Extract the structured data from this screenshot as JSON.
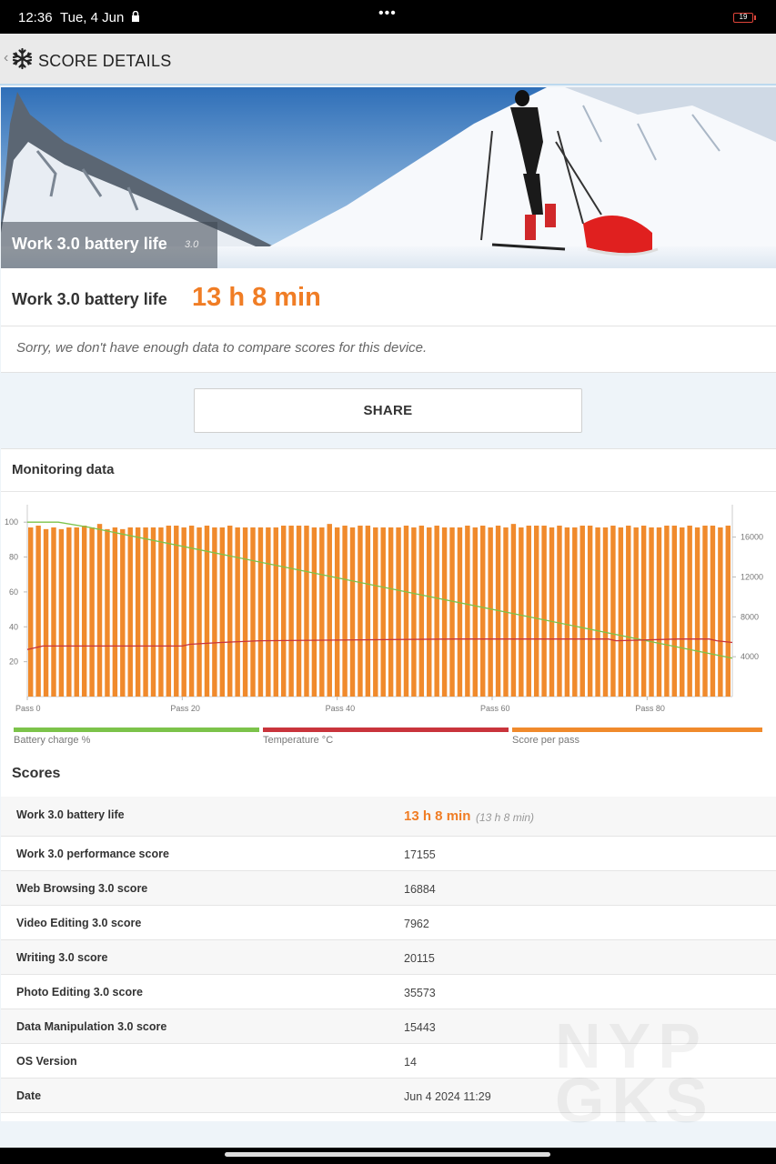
{
  "status_bar": {
    "time": "12:36",
    "date": "Tue, 4 Jun",
    "more_label": "•••",
    "battery_level": "19"
  },
  "app_bar": {
    "back_label": "‹",
    "title": "SCORE DETAILS"
  },
  "hero": {
    "title": "Work 3.0 battery life",
    "version": "3.0"
  },
  "result": {
    "label": "Work 3.0 battery life",
    "value": "13 h 8 min"
  },
  "notice": "Sorry, we don't have enough data to compare scores for this device.",
  "share_label": "SHARE",
  "monitoring": {
    "title": "Monitoring data"
  },
  "chart_data": {
    "type": "bar",
    "title": "",
    "x_tick_labels": [
      "Pass 0",
      "Pass 20",
      "Pass 40",
      "Pass 60",
      "Pass 80"
    ],
    "x_range": [
      0,
      91
    ],
    "y_left_ticks": [
      20,
      40,
      60,
      80,
      100
    ],
    "y_left_range": [
      0,
      110
    ],
    "y_right_ticks": [
      4000,
      8000,
      12000,
      16000
    ],
    "y_right_range": [
      0,
      19250
    ],
    "grid": true,
    "legend_placement": "bottom",
    "series": [
      {
        "name": "Score per pass",
        "axis": "right",
        "color": "#f08a2c",
        "values": [
          16970,
          17150,
          16800,
          16970,
          16800,
          16970,
          16970,
          17150,
          16970,
          17320,
          16800,
          16970,
          16800,
          16970,
          16970,
          16970,
          16970,
          16970,
          17150,
          17150,
          16970,
          17150,
          16970,
          17150,
          16970,
          16970,
          17150,
          16970,
          16970,
          16970,
          16970,
          16970,
          16970,
          17150,
          17150,
          17150,
          17150,
          16970,
          16970,
          17320,
          16970,
          17150,
          16970,
          17150,
          17150,
          16970,
          16970,
          16970,
          16970,
          17150,
          16970,
          17150,
          16970,
          17150,
          16970,
          16970,
          16970,
          17150,
          16970,
          17150,
          16970,
          17150,
          16970,
          17320,
          16970,
          17150,
          17150,
          17150,
          16970,
          17150,
          16970,
          16970,
          17150,
          17150,
          16970,
          16970,
          17150,
          16970,
          17150,
          16970,
          17150,
          16970,
          16970,
          17150,
          17150,
          16970,
          17150,
          16970,
          17150,
          17150,
          16970,
          17150
        ]
      },
      {
        "name": "Battery charge %",
        "axis": "left",
        "color": "#7cc34a",
        "x": [
          0,
          4,
          8,
          91
        ],
        "values": [
          100,
          100,
          97,
          22
        ]
      },
      {
        "name": "Temperature °C",
        "axis": "left",
        "color": "#c9343c",
        "x": [
          0,
          2,
          20,
          21,
          25,
          30,
          55,
          75,
          76,
          84,
          85,
          88,
          89,
          91
        ],
        "values": [
          27,
          29,
          29,
          30,
          31,
          32,
          33,
          33,
          32,
          33,
          33,
          33,
          32,
          31
        ]
      }
    ]
  },
  "legend": [
    {
      "label": "Battery charge %",
      "color": "#7cc34a"
    },
    {
      "label": "Temperature °C",
      "color": "#c9343c"
    },
    {
      "label": "Score per pass",
      "color": "#f08a2c"
    }
  ],
  "scores": {
    "title": "Scores",
    "battery_row": {
      "label": "Work 3.0 battery life",
      "value": "13 h 8 min",
      "sub": "(13 h 8 min)"
    },
    "rows": [
      {
        "label": "Work 3.0 performance score",
        "value": "17155"
      },
      {
        "label": "Web Browsing 3.0 score",
        "value": "16884"
      },
      {
        "label": "Video Editing 3.0 score",
        "value": "7962"
      },
      {
        "label": "Writing 3.0 score",
        "value": "20115"
      },
      {
        "label": "Photo Editing 3.0 score",
        "value": "35573"
      },
      {
        "label": "Data Manipulation 3.0 score",
        "value": "15443"
      },
      {
        "label": "OS Version",
        "value": "14"
      },
      {
        "label": "Date",
        "value": "Jun 4 2024 11:29"
      }
    ]
  },
  "colors": {
    "accent": "#f07d25",
    "appbar_line": "#bcd9ee"
  }
}
